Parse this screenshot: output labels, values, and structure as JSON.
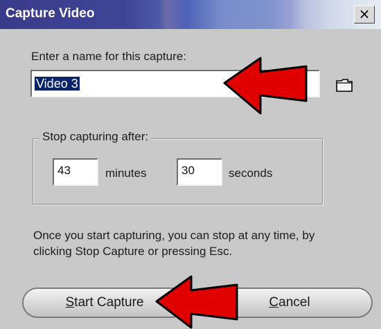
{
  "window": {
    "title": "Capture Video",
    "close_glyph": "×"
  },
  "form": {
    "name_label": "Enter a name for this capture:",
    "name_value": "Video 3",
    "folder_icon": "folder-icon",
    "stop_group_label": "Stop capturing after:",
    "minutes_value": "43",
    "minutes_label": "minutes",
    "seconds_value": "30",
    "seconds_label": "seconds",
    "info_line1": "Once you start capturing, you can stop at any time, by",
    "info_line2": "clicking Stop Capture or pressing Esc."
  },
  "buttons": {
    "start_label": "Start Capture",
    "start_mnemonic": "S",
    "cancel_label": "Cancel",
    "cancel_mnemonic": "C"
  },
  "annotations": {
    "arrow_color": "#e00000",
    "arrow_outline": "#000000"
  }
}
